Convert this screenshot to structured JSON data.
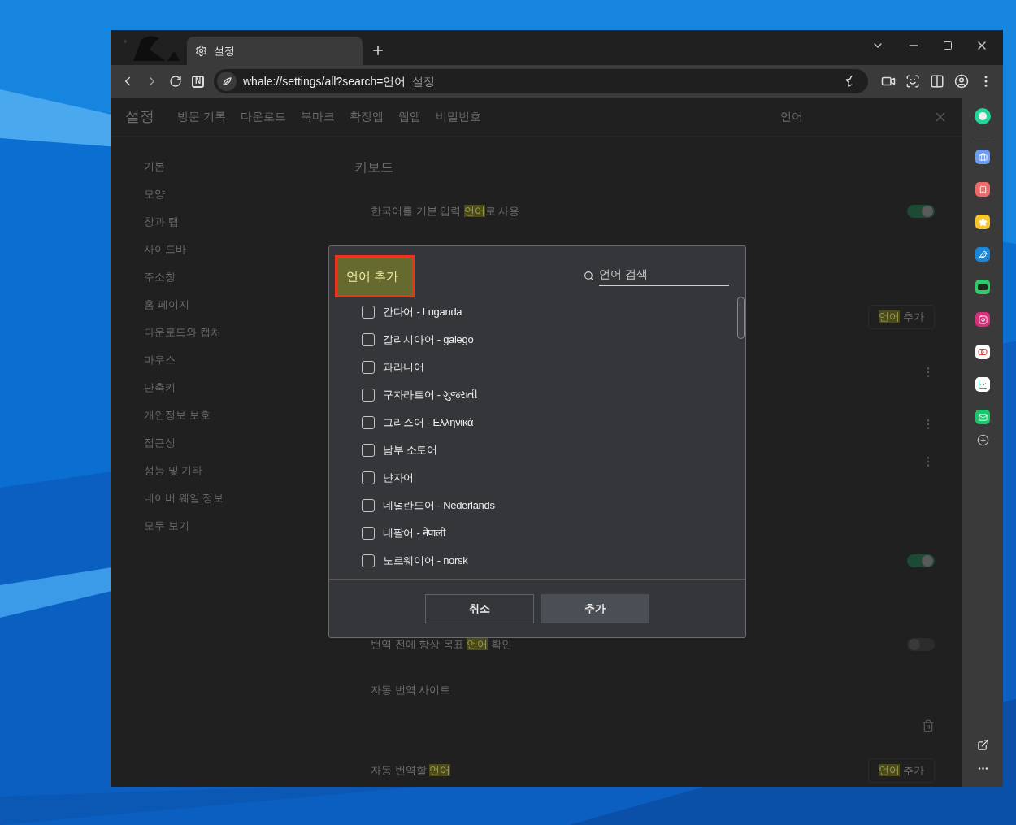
{
  "window": {
    "tab": {
      "title": "설정"
    },
    "toolbar": {
      "n_button": "N"
    },
    "address": {
      "url": "whale://settings/all?search=언어",
      "hint": "설정"
    }
  },
  "settings": {
    "title": "설정",
    "nav": [
      "방문 기록",
      "다운로드",
      "북마크",
      "확장앱",
      "웹앱",
      "비밀번호"
    ],
    "search": {
      "value": "언어"
    },
    "sidebar": [
      "기본",
      "모양",
      "창과 탭",
      "사이드바",
      "주소창",
      "홈 페이지",
      "다운로드와 캡처",
      "마우스",
      "단축키",
      "개인정보 보호",
      "접근성",
      "성능 및 기타",
      "네이버 웨일 정보",
      "모두 보기"
    ],
    "section_title": "키보드",
    "rows": [
      {
        "kind": "toggle",
        "pre": "한국어를 기본 입력 ",
        "mark": "언어",
        "post": "로 사용",
        "on": true
      },
      {
        "kind": "add",
        "mark": "언어",
        "post": " 추가"
      },
      {
        "kind": "menu"
      },
      {
        "kind": "menu"
      },
      {
        "kind": "menu"
      },
      {
        "kind": "toggle",
        "on": true
      },
      {
        "kind": "toggle",
        "pre": "번역 전에 항상 목표 ",
        "mark": "언어",
        "post": " 확인",
        "on": false
      },
      {
        "kind": "label",
        "pre": "자동 번역 사이트"
      },
      {
        "kind": "trash"
      },
      {
        "kind": "add",
        "pre": "자동 번역할 ",
        "mark": "언어",
        "post": "",
        "button_mark": "언어",
        "button_post": " 추가"
      }
    ]
  },
  "dialog": {
    "title": "언어 추가",
    "search": {
      "placeholder": "언어 검색"
    },
    "languages": [
      {
        "label": "간다어 - Luganda",
        "checked": false
      },
      {
        "label": "갈리시아어 - galego",
        "checked": false
      },
      {
        "label": "과라니어",
        "checked": false
      },
      {
        "label": "구자라트어 - ગુજરાતી",
        "checked": false
      },
      {
        "label": "그리스어 - Ελληνικά",
        "checked": false
      },
      {
        "label": "남부 소토어",
        "checked": false
      },
      {
        "label": "냔자어",
        "checked": false
      },
      {
        "label": "네덜란드어 - Nederlands",
        "checked": false
      },
      {
        "label": "네팔어 - नेपाली",
        "checked": false
      },
      {
        "label": "노르웨이어 - norsk",
        "checked": false
      }
    ],
    "buttons": [
      {
        "label": "취소",
        "kind": "secondary"
      },
      {
        "label": "추가",
        "kind": "primary"
      }
    ]
  }
}
